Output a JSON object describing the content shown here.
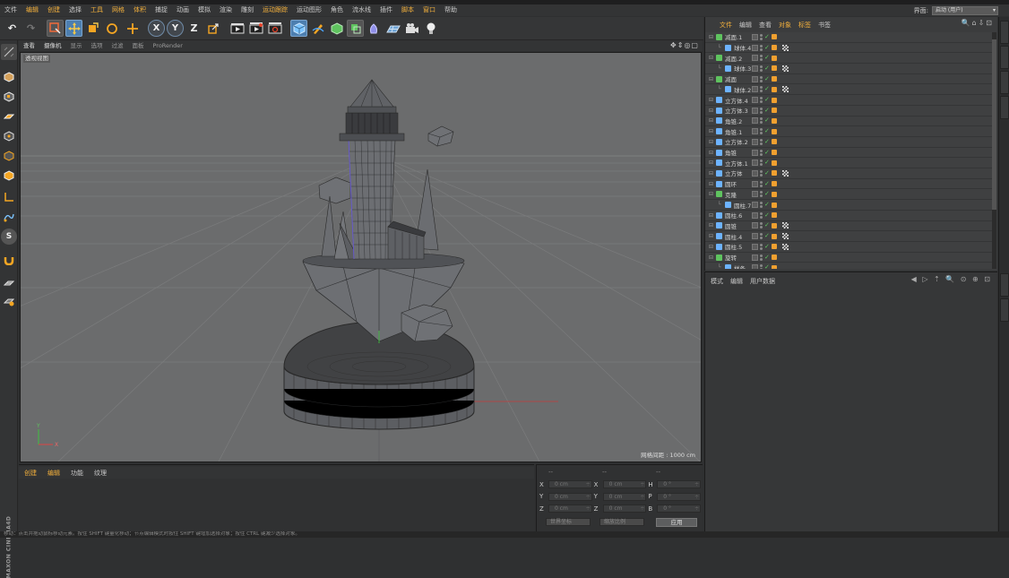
{
  "menu": {
    "items": [
      "文件",
      "编辑",
      "创建",
      "选择",
      "工具",
      "网格",
      "体积",
      "捕捉",
      "动画",
      "模拟",
      "渲染",
      "雕刻",
      "运动跟踪",
      "运动图形",
      "角色",
      "流水线",
      "插件",
      "脚本",
      "窗口",
      "帮助"
    ],
    "highlighted": [
      "编辑",
      "创建",
      "工具",
      "网格",
      "体积",
      "运动跟踪",
      "脚本",
      "窗口"
    ],
    "layout_label": "界面:",
    "layout_value": "启动 (用户)"
  },
  "toolbar": {
    "axis_x": "X",
    "axis_y": "Y",
    "axis_z": "Z"
  },
  "viewport": {
    "menu": [
      "查看",
      "摄像机",
      "显示",
      "选项",
      "过滤",
      "面板",
      "ProRender"
    ],
    "menu_highlighted": [
      "查看",
      "摄像机"
    ],
    "label": "透视视图",
    "grid_distance": "网格间距 : 1000 cm",
    "nav_icons": "✥⇕◎▢"
  },
  "material_manager": {
    "menu": [
      "创建",
      "编辑",
      "功能",
      "纹理"
    ],
    "highlighted": [
      "创建",
      "编辑"
    ]
  },
  "coordinates": {
    "header": [
      "--",
      "--",
      "--"
    ],
    "rows": [
      {
        "a": "X",
        "av": "0 cm",
        "b": "X",
        "bv": "0 cm",
        "c": "H",
        "cv": "0 °"
      },
      {
        "a": "Y",
        "av": "0 cm",
        "b": "Y",
        "bv": "0 cm",
        "c": "P",
        "cv": "0 °"
      },
      {
        "a": "Z",
        "av": "0 cm",
        "b": "Z",
        "bv": "0 cm",
        "c": "B",
        "cv": "0 °"
      }
    ],
    "world_select": "世界坐标",
    "scale_select": "缩放比例",
    "apply": "应用"
  },
  "object_manager": {
    "menu": [
      "文件",
      "编辑",
      "查看",
      "对象",
      "标签",
      "书签"
    ],
    "highlighted": [
      "文件",
      "对象",
      "标签"
    ],
    "icons": "🔍⌂⇩⊡",
    "items": [
      {
        "name": "减面.1",
        "indent": 0,
        "color": "#5fc35f",
        "checker": false
      },
      {
        "name": "球体.4",
        "indent": 1,
        "color": "#6db3ff",
        "checker": true
      },
      {
        "name": "减面.2",
        "indent": 0,
        "color": "#5fc35f",
        "checker": false
      },
      {
        "name": "球体.3",
        "indent": 1,
        "color": "#6db3ff",
        "checker": true
      },
      {
        "name": "减面",
        "indent": 0,
        "color": "#5fc35f",
        "checker": false
      },
      {
        "name": "球体.2",
        "indent": 1,
        "color": "#6db3ff",
        "checker": true
      },
      {
        "name": "立方体.4",
        "indent": 0,
        "color": "#6db3ff",
        "checker": false
      },
      {
        "name": "立方体.3",
        "indent": 0,
        "color": "#6db3ff",
        "checker": false
      },
      {
        "name": "角锥.2",
        "indent": 0,
        "color": "#6db3ff",
        "checker": false
      },
      {
        "name": "角锥.1",
        "indent": 0,
        "color": "#6db3ff",
        "checker": false
      },
      {
        "name": "立方体.2",
        "indent": 0,
        "color": "#6db3ff",
        "checker": false
      },
      {
        "name": "角锥",
        "indent": 0,
        "color": "#6db3ff",
        "checker": false
      },
      {
        "name": "立方体.1",
        "indent": 0,
        "color": "#6db3ff",
        "checker": false
      },
      {
        "name": "立方体",
        "indent": 0,
        "color": "#6db3ff",
        "checker": true
      },
      {
        "name": "圆环",
        "indent": 0,
        "color": "#6db3ff",
        "checker": false
      },
      {
        "name": "克隆",
        "indent": 0,
        "color": "#5fc35f",
        "checker": false
      },
      {
        "name": "圆柱.7",
        "indent": 1,
        "color": "#6db3ff",
        "checker": false
      },
      {
        "name": "圆柱.6",
        "indent": 0,
        "color": "#6db3ff",
        "checker": false
      },
      {
        "name": "圆锥",
        "indent": 0,
        "color": "#6db3ff",
        "checker": true
      },
      {
        "name": "圆柱.4",
        "indent": 0,
        "color": "#6db3ff",
        "checker": true
      },
      {
        "name": "圆柱.5",
        "indent": 0,
        "color": "#6db3ff",
        "checker": true
      },
      {
        "name": "旋转",
        "indent": 0,
        "color": "#5fc35f",
        "checker": false
      },
      {
        "name": "样条",
        "indent": 1,
        "color": "#6db3ff",
        "checker": false
      }
    ]
  },
  "attribute_manager": {
    "menu": [
      "模式",
      "编辑",
      "用户数据"
    ],
    "icons": "◀ ▷ ⇡ 🔍 ⊙ ⊕ ⊡"
  },
  "logo": "MAXON CINEMA4D",
  "statusbar": "移动：点击并拖动鼠标移动元素。按住 SHIFT 键量化移动；节点编辑模式时按住 SHIFT 键增加选择对象；按住 CTRL 键减少选择对象。"
}
